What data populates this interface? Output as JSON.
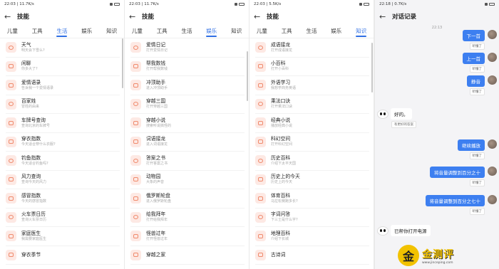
{
  "phones": [
    {
      "status_time": "22:03 | 11.7K/s",
      "title": "技能",
      "active_tab": 2,
      "items": [
        {
          "name": "天气",
          "desc": "明天会下雪么?"
        },
        {
          "name": "闲聊",
          "desc": "你多大了?"
        },
        {
          "name": "爱情语录",
          "desc": "告诉我一个爱情语录"
        },
        {
          "name": "百家姓",
          "desc": "冒姓的由来"
        },
        {
          "name": "车牌号查询",
          "desc": "查询北京的车牌号"
        },
        {
          "name": "穿衣指数",
          "desc": "今天适合穿什么衣服?"
        },
        {
          "name": "钓鱼指数",
          "desc": "今天适合钓鱼吗?"
        },
        {
          "name": "风力查询",
          "desc": "查询今天的风力"
        },
        {
          "name": "感冒指数",
          "desc": "今天的感冒指数"
        },
        {
          "name": "火车票日历",
          "desc": "查询火车票日历"
        },
        {
          "name": "家庭医生",
          "desc": "我需要家庭医生"
        },
        {
          "name": "穿衣季节",
          "desc": ""
        }
      ]
    },
    {
      "status_time": "22:03 | 11.7K/s",
      "title": "技能",
      "active_tab": 3,
      "items": [
        {
          "name": "爱情日记",
          "desc": "打开爱情日记"
        },
        {
          "name": "帮我数钱",
          "desc": "打开帮我数钱"
        },
        {
          "name": "冲顶助手",
          "desc": "进入冲顶助手"
        },
        {
          "name": "穿越三国",
          "desc": "打开穿越三国"
        },
        {
          "name": "穿越小说",
          "desc": "搜索听说搞怪的"
        },
        {
          "name": "词语接龙",
          "desc": "进入词语接龙"
        },
        {
          "name": "答案之书",
          "desc": "打开答案之书"
        },
        {
          "name": "动物园",
          "desc": "大象的声音"
        },
        {
          "name": "俄罗斯轮盘",
          "desc": "进入俄罗斯轮盘"
        },
        {
          "name": "给我拜年",
          "desc": "打开给我拜年"
        },
        {
          "name": "怪兽过年",
          "desc": "打开怪兽过年"
        },
        {
          "name": "穿越之家",
          "desc": ""
        }
      ]
    },
    {
      "status_time": "22:03 | 5.5K/s",
      "title": "技能",
      "active_tab": 4,
      "items": [
        {
          "name": "成语接龙",
          "desc": "打开成语接龙"
        },
        {
          "name": "小百科",
          "desc": "打开小百科"
        },
        {
          "name": "外语学习",
          "desc": "我想学商务英语"
        },
        {
          "name": "乘法口诀",
          "desc": "打开乘法口诀"
        },
        {
          "name": "经典小说",
          "desc": "播放经典小说"
        },
        {
          "name": "科幻空间",
          "desc": "打开科幻空间"
        },
        {
          "name": "历史百科",
          "desc": "介绍下太平天国"
        },
        {
          "name": "历史上的今天",
          "desc": "历史上的今天"
        },
        {
          "name": "体育百科",
          "desc": "马拉松赛跑多长?"
        },
        {
          "name": "字词问答",
          "desc": "下三士是什么字?"
        },
        {
          "name": "地理百科",
          "desc": "介绍下长城"
        },
        {
          "name": "古诗词",
          "desc": ""
        }
      ]
    }
  ],
  "tabs": [
    "儿童",
    "工具",
    "生活",
    "娱乐",
    "知识"
  ],
  "chat": {
    "status_time": "22:18 | 0.7K/s",
    "title": "对话记录",
    "time_label": "22:13",
    "messages": [
      {
        "side": "right",
        "text": "下一首",
        "tag": "听懂了"
      },
      {
        "side": "right",
        "text": "上一首",
        "tag": "听懂了"
      },
      {
        "side": "right",
        "text": "静音",
        "tag": "听懂了"
      },
      {
        "side": "left",
        "text": "好的。",
        "tag": "有更好的答案"
      },
      {
        "side": "right",
        "text": "继续播放",
        "tag": "听懂了"
      },
      {
        "side": "right",
        "text": "将音量调整到百分之十",
        "tag": "听懂了"
      },
      {
        "side": "right",
        "text": "将音量调整到百分之七十",
        "tag": "听懂了"
      },
      {
        "side": "left",
        "text": "已帮你打开电源",
        "tag": ""
      }
    ]
  },
  "watermark": {
    "logo": "金",
    "title": "金测评",
    "url": "www.jinceping.com"
  }
}
